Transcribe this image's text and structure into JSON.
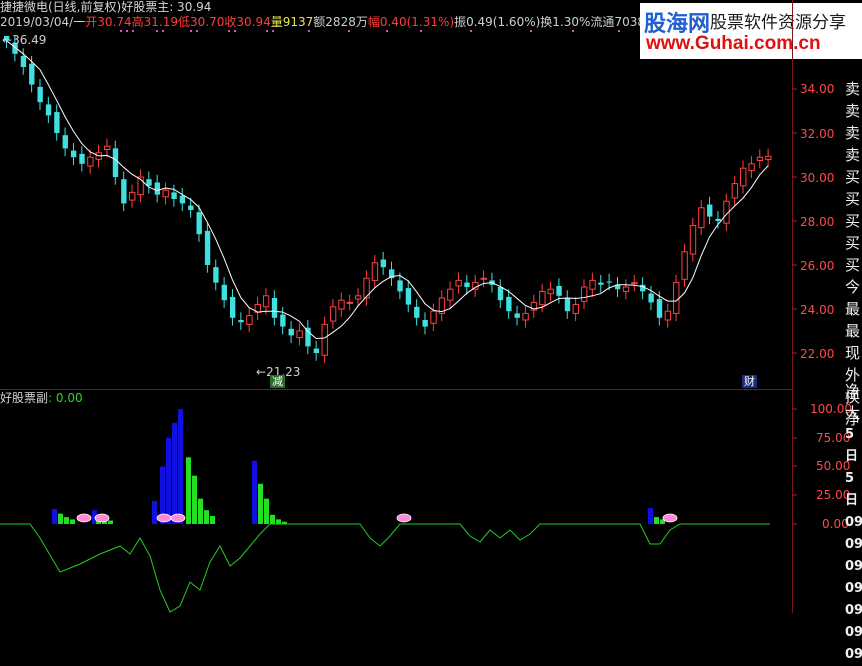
{
  "header": {
    "app": "捷捷微电(日线,前复权)",
    "indicator_title": "好股票主",
    "indicator_value": ": 30.94",
    "date": "2019/03/04/一",
    "open_label": "开",
    "open_value": "30.74",
    "high_label": "高",
    "high_value": "31.19",
    "low_label": "低",
    "low_value": "30.70",
    "close_label": "收",
    "close_value": "30.94",
    "vol_label": "量",
    "vol_value": "9137",
    "amount_label": "额",
    "amount_value": "2828万",
    "range_label": "幅",
    "range_value": "0.40(1.31%)",
    "amp_label": "振",
    "amp_value": "0.49(1.60%)",
    "turn_label": "换",
    "turn_value": "1.30%",
    "float_label": "流通",
    "float_value": "7038万"
  },
  "watermark": {
    "site_name": "股海网",
    "tagline": "股票软件资源分享",
    "url": "www.Guhai.com.cn"
  },
  "main_chart": {
    "price_high_marker": "36.49",
    "price_low_marker": "21.23",
    "yaxis_ticks": [
      "34.00",
      "32.00",
      "30.00",
      "28.00",
      "26.00",
      "24.00",
      "22.00"
    ],
    "event_marks": [
      "减",
      "财"
    ]
  },
  "sub_chart": {
    "title": "好股票副",
    "value": ": 0.00",
    "yaxis_ticks": [
      "100.00",
      "75.00",
      "50.00",
      "25.00",
      "0.00"
    ]
  },
  "right_panel": {
    "items_top": [
      "卖",
      "卖",
      "卖",
      "卖",
      "买",
      "买",
      "买",
      "买",
      "买",
      "今",
      "最",
      "最",
      "现",
      "外",
      "换",
      "净"
    ],
    "items_bottom": [
      "净",
      "大",
      "5日",
      "5日",
      "09",
      "09",
      "09",
      "09",
      "09",
      "09",
      "09",
      "09",
      "09",
      "09"
    ]
  },
  "chart_data": {
    "type": "candlestick",
    "ylim": [
      21,
      36.5
    ],
    "up_color": "#ff4040",
    "down_color": "#40e0e0",
    "closes": [
      36.2,
      35.6,
      35.0,
      34.2,
      33.4,
      32.8,
      32.0,
      31.3,
      30.9,
      30.6,
      30.9,
      31.1,
      31.4,
      30.0,
      28.8,
      29.3,
      30.0,
      29.6,
      29.2,
      29.4,
      29.0,
      28.8,
      28.5,
      27.4,
      26.0,
      25.2,
      24.4,
      23.6,
      23.4,
      23.7,
      24.2,
      24.6,
      23.6,
      23.2,
      22.8,
      23.0,
      22.3,
      22.0,
      23.3,
      24.1,
      24.4,
      24.3,
      24.6,
      25.4,
      26.1,
      25.9,
      25.4,
      24.8,
      24.2,
      23.6,
      23.2,
      23.9,
      24.5,
      24.9,
      25.3,
      25.0,
      25.2,
      25.4,
      25.1,
      24.4,
      23.9,
      23.6,
      23.8,
      24.3,
      24.8,
      24.9,
      24.6,
      23.9,
      24.2,
      25.0,
      25.3,
      25.1,
      25.2,
      24.9,
      25.0,
      25.2,
      24.8,
      24.3,
      23.6,
      23.9,
      25.2,
      26.6,
      27.8,
      28.6,
      28.2,
      28.0,
      28.9,
      29.7,
      30.4,
      30.6,
      30.9,
      30.94
    ],
    "sub_bars_blue": [
      [
        52,
        13
      ],
      [
        92,
        12
      ],
      [
        152,
        20
      ],
      [
        160,
        50
      ],
      [
        166,
        75
      ],
      [
        172,
        88
      ],
      [
        178,
        100
      ],
      [
        252,
        55
      ],
      [
        648,
        14
      ]
    ],
    "sub_bars_green": [
      [
        58,
        9
      ],
      [
        64,
        6
      ],
      [
        70,
        4
      ],
      [
        96,
        6
      ],
      [
        102,
        4
      ],
      [
        108,
        3
      ],
      [
        186,
        58
      ],
      [
        192,
        42
      ],
      [
        198,
        22
      ],
      [
        204,
        12
      ],
      [
        210,
        7
      ],
      [
        258,
        35
      ],
      [
        264,
        22
      ],
      [
        270,
        8
      ],
      [
        276,
        4
      ],
      [
        282,
        2
      ],
      [
        654,
        6
      ],
      [
        660,
        4
      ]
    ],
    "sub_line": [
      [
        0,
        0
      ],
      [
        30,
        0
      ],
      [
        40,
        -14
      ],
      [
        60,
        -48
      ],
      [
        80,
        -40
      ],
      [
        100,
        -30
      ],
      [
        120,
        -22
      ],
      [
        130,
        -30
      ],
      [
        140,
        -14
      ],
      [
        150,
        -32
      ],
      [
        160,
        -66
      ],
      [
        170,
        -88
      ],
      [
        180,
        -82
      ],
      [
        190,
        -58
      ],
      [
        200,
        -66
      ],
      [
        210,
        -38
      ],
      [
        220,
        -22
      ],
      [
        230,
        -42
      ],
      [
        240,
        -34
      ],
      [
        250,
        -22
      ],
      [
        260,
        -10
      ],
      [
        270,
        0
      ],
      [
        360,
        0
      ],
      [
        370,
        -14
      ],
      [
        380,
        -22
      ],
      [
        390,
        -12
      ],
      [
        400,
        0
      ],
      [
        460,
        0
      ],
      [
        470,
        -12
      ],
      [
        480,
        -18
      ],
      [
        490,
        -6
      ],
      [
        500,
        -14
      ],
      [
        510,
        -6
      ],
      [
        520,
        -16
      ],
      [
        530,
        -10
      ],
      [
        540,
        0
      ],
      [
        640,
        0
      ],
      [
        650,
        -20
      ],
      [
        660,
        -20
      ],
      [
        670,
        -6
      ],
      [
        680,
        0
      ],
      [
        770,
        0
      ]
    ]
  }
}
